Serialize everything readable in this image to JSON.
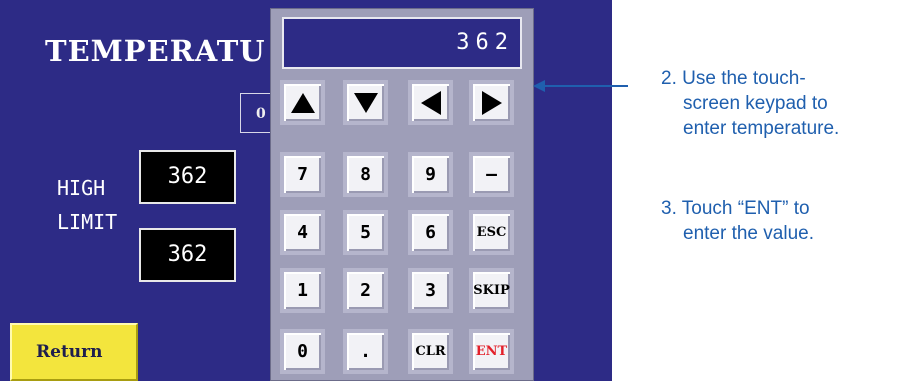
{
  "screen": {
    "title": "TEMPERATU",
    "partial_field": "0",
    "labels": {
      "high": "HIGH",
      "limit": "LIMIT"
    },
    "high_value": "362",
    "limit_value": "362",
    "return_label": "Return"
  },
  "keypad": {
    "display": "362",
    "arrows": [
      {
        "icon": "up-triangle-icon"
      },
      {
        "icon": "down-triangle-icon"
      },
      {
        "icon": "left-triangle-icon"
      },
      {
        "icon": "right-triangle-icon"
      }
    ],
    "keys": [
      "7",
      "8",
      "9",
      "—",
      "4",
      "5",
      "6",
      "ESC",
      "1",
      "2",
      "3",
      "SKIP",
      "0",
      ".",
      "CLR",
      "ENT"
    ],
    "colors": {
      "ent": "#e3202a"
    }
  },
  "instructions": {
    "step2": [
      "2.  Use the touch-",
      "screen keypad to",
      "enter temperature."
    ],
    "step3": [
      "3.  Touch “ENT” to",
      "enter the value."
    ]
  },
  "colors": {
    "screen_bg": "#2d2b86",
    "keypad_bg": "#9e9eb8",
    "return_bg": "#f3e53d",
    "annotation": "#1f5fae"
  }
}
